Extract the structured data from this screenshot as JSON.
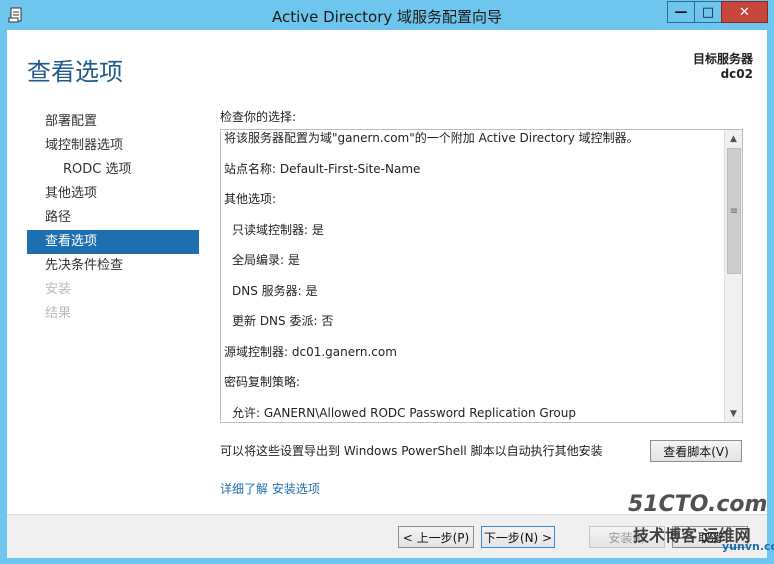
{
  "window": {
    "title": "Active Directory 域服务配置向导",
    "min_glyph": "—",
    "max_glyph": "□",
    "close_glyph": "✕"
  },
  "header": {
    "page_title": "查看选项",
    "target_server_label": "目标服务器",
    "target_server_name": "dc02"
  },
  "nav": {
    "items": [
      {
        "label": "部署配置"
      },
      {
        "label": "域控制器选项"
      },
      {
        "label": "RODC 选项"
      },
      {
        "label": "其他选项"
      },
      {
        "label": "路径"
      },
      {
        "label": "查看选项"
      },
      {
        "label": "先决条件检查"
      },
      {
        "label": "安装"
      },
      {
        "label": "结果"
      }
    ]
  },
  "review": {
    "label": "检查你的选择:",
    "lines": [
      "将该服务器配置为域\"ganern.com\"的一个附加 Active Directory 域控制器。",
      "站点名称: Default-First-Site-Name",
      "其他选项:",
      "只读域控制器: 是",
      "全局编录: 是",
      "DNS 服务器: 是",
      "更新 DNS 委派: 否",
      "源域控制器: dc01.ganern.com",
      "密码复制策略:",
      "允许: GANERN\\Allowed RODC Password Replication Group"
    ]
  },
  "export": {
    "text": "可以将这些设置导出到 Windows PowerShell 脚本以自动执行其他安装",
    "view_script_label": "查看脚本(V)"
  },
  "more_link": "详细了解 安装选项",
  "footer": {
    "prev_label": "< 上一步(P)",
    "next_label": "下一步(N) >",
    "install_label": "安装(I)",
    "cancel_label": "取消"
  },
  "watermark": {
    "line1": "51CTO.com",
    "line2": "技术博客 运维网",
    "line3": "yunvn.com"
  },
  "colors": {
    "titlebar": "#6ec6ee",
    "accent": "#1e6fb0",
    "page_title": "#1e5a8c",
    "close": "#c7463c"
  }
}
